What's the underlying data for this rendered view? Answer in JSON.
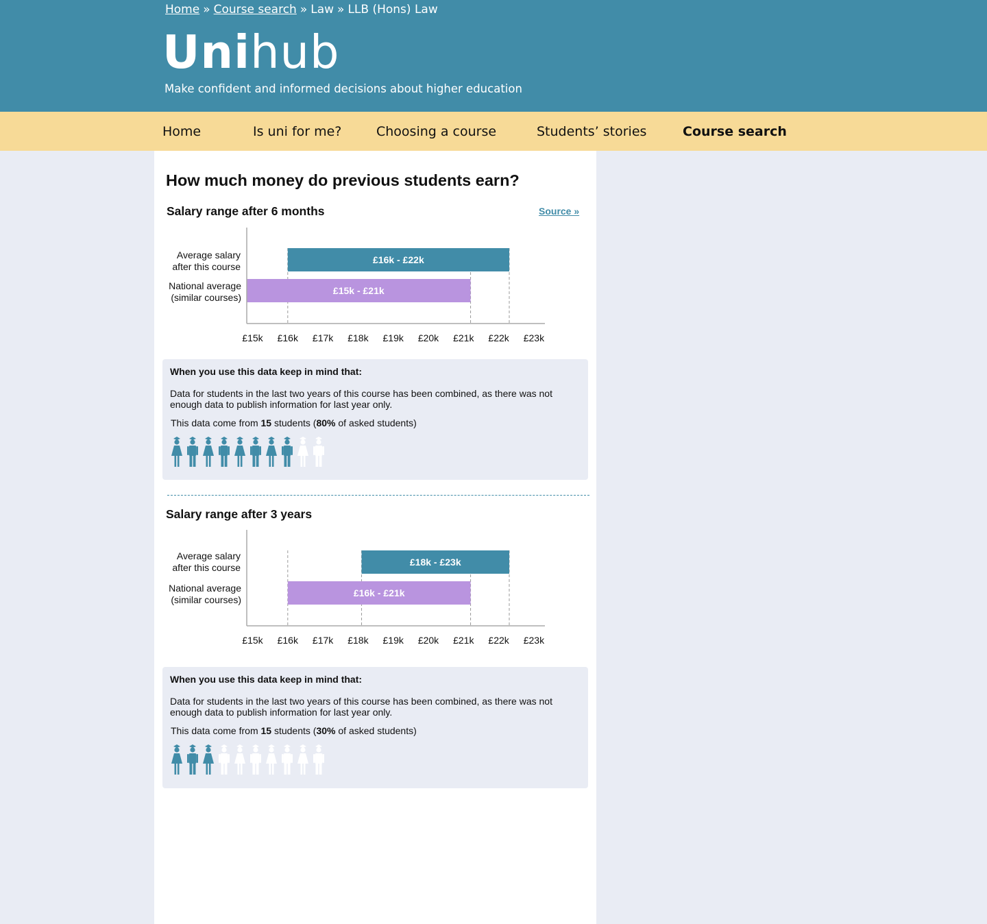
{
  "breadcrumb": {
    "home": "Home",
    "course_search": "Course search",
    "sep": "»",
    "law": "Law",
    "course": "LLB (Hons) Law"
  },
  "logo": {
    "bold": "Uni",
    "light": "hub"
  },
  "tagline": "Make confident and informed decisions about higher education",
  "nav": {
    "items": [
      {
        "label": "Home"
      },
      {
        "label": "Is uni for me?"
      },
      {
        "label": "Choosing a course"
      },
      {
        "label": "Students’ stories"
      },
      {
        "label": "Course search",
        "active": true
      }
    ]
  },
  "page_title": "How much money do previous students earn?",
  "source_label": "Source »",
  "colors": {
    "header": "#418ca8",
    "nav": "#f7da97",
    "course_bar": "#418ca8",
    "national_bar": "#b994df",
    "page_bg": "#e9ecf4"
  },
  "row_labels": {
    "course": [
      "Average salary",
      "after this course"
    ],
    "national": [
      "National average",
      "(similar courses)"
    ]
  },
  "note_heading": "When you use this data keep in mind that:",
  "note_body": "Data for students in the last two years of this course has been combined, as there was not enough data to publish information for last year only.",
  "count_text": {
    "prefix": "This data come from ",
    "students_suffix": " students (",
    "pct_suffix": " of asked students)"
  },
  "chart_data": [
    {
      "type": "bar",
      "title": "Salary range after 6 months",
      "x_ticks": [
        "£15k",
        "£16k",
        "£17k",
        "£18k",
        "£19k",
        "£20k",
        "£21k",
        "£22k",
        "£23k"
      ],
      "xlim": [
        15,
        23
      ],
      "bars": [
        {
          "label": "Average salary after this course",
          "low": 16,
          "high": 22.3,
          "text": "£16k - £22k",
          "color": "#418ca8"
        },
        {
          "label": "National average (similar courses)",
          "low": 15,
          "high": 21.2,
          "text": "£15k - £21k",
          "color": "#b994df"
        }
      ],
      "response": {
        "students": "15",
        "percent": "80%",
        "icons_total": 10,
        "icons_filled": 8
      }
    },
    {
      "type": "bar",
      "title": "Salary range after 3 years",
      "x_ticks": [
        "£15k",
        "£16k",
        "£17k",
        "£18k",
        "£19k",
        "£20k",
        "£21k",
        "£22k",
        "£23k"
      ],
      "xlim": [
        15,
        23
      ],
      "bars": [
        {
          "label": "Average salary after this course",
          "low": 18.1,
          "high": 22.3,
          "text": "£18k - £23k",
          "color": "#418ca8"
        },
        {
          "label": "National average (similar courses)",
          "low": 16,
          "high": 21.2,
          "text": "£16k - £21k",
          "color": "#b994df"
        }
      ],
      "response": {
        "students": "15",
        "percent": "30%",
        "icons_total": 10,
        "icons_filled": 3
      }
    }
  ]
}
